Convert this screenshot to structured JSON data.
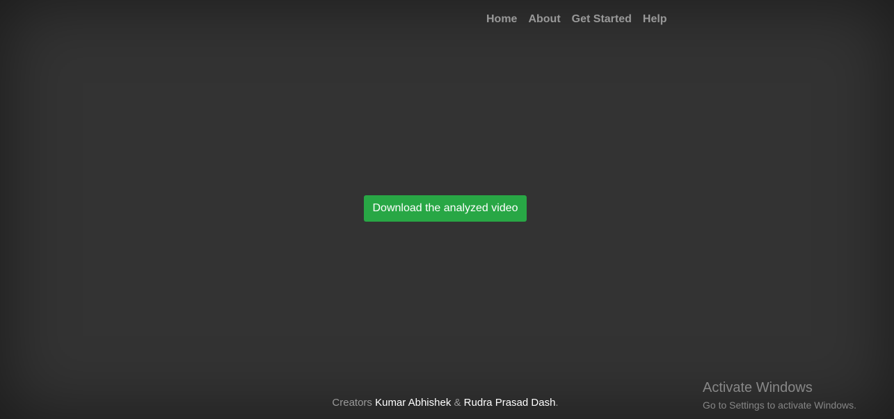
{
  "nav": {
    "items": [
      {
        "label": "Home"
      },
      {
        "label": "About"
      },
      {
        "label": "Get Started"
      },
      {
        "label": "Help"
      }
    ]
  },
  "main": {
    "download_label": "Download the analyzed video"
  },
  "footer": {
    "prefix": "Creators ",
    "creator1": "Kumar Abhishek",
    "separator": " & ",
    "creator2": "Rudra Prasad Dash",
    "suffix": "."
  },
  "watermark": {
    "title": "Activate Windows",
    "subtitle": "Go to Settings to activate Windows."
  },
  "colors": {
    "background": "#333333",
    "accent": "#28a745",
    "nav_text": "#999999"
  }
}
